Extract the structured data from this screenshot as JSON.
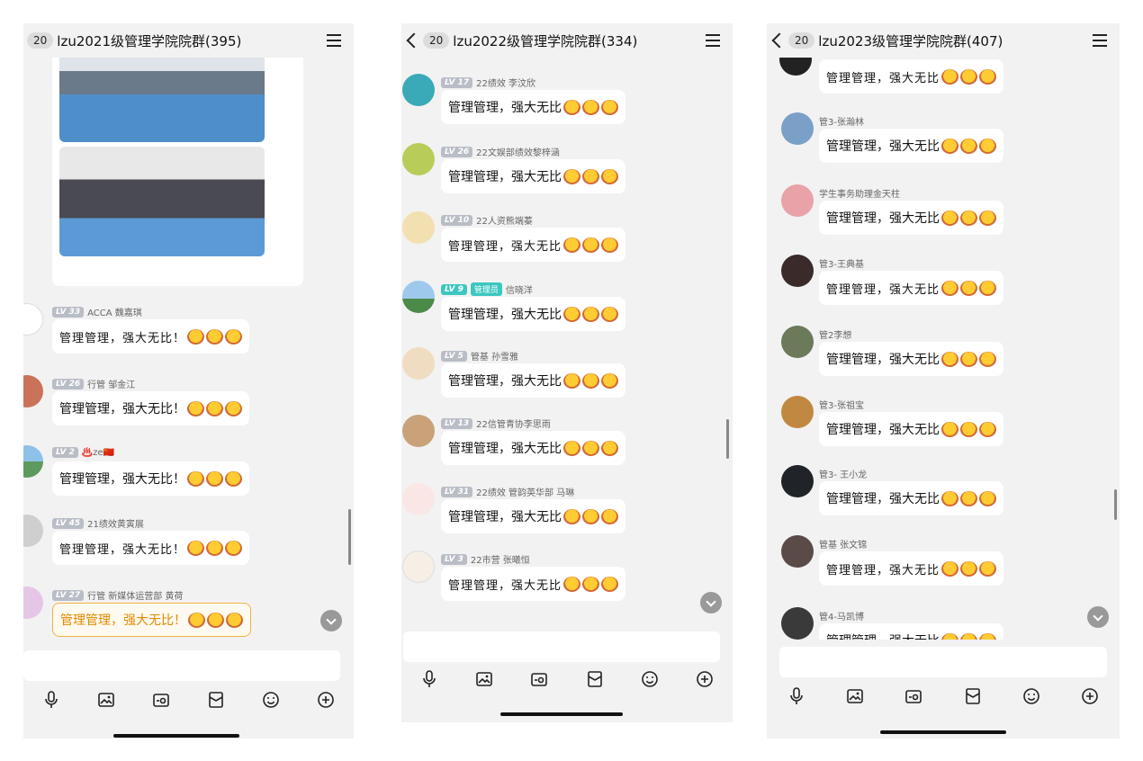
{
  "colors": {
    "lv_badge": "#b9bdc6",
    "admin_badge": "#3cc7c0",
    "bubble": "#ffffff",
    "background": "#f2f2f2"
  },
  "panels": [
    {
      "unread": "20",
      "title": "lzu2021级管理学院院群(395)",
      "messages": [
        {
          "level": "LV 33",
          "name": "ACCA 魏嘉琪",
          "text": "管理管理，强大无比！",
          "style": "hand"
        },
        {
          "level": "LV 26",
          "name": "行管 邹金江",
          "text": "管理管理，强大无比！",
          "style": "normal"
        },
        {
          "level": "LV 2",
          "name": "♨️ze🇨🇳",
          "text": "管理管理，强大无比！",
          "style": "normal"
        },
        {
          "level": "LV 45",
          "name": "21绩效黄寅展",
          "text": "管理管理，强大无比！",
          "style": "hand"
        },
        {
          "level": "LV 27",
          "name": "行管 新媒体运营部  黄荷",
          "text": "管理管理，强大无比！",
          "style": "special"
        }
      ]
    },
    {
      "unread": "20",
      "title": "lzu2022级管理学院院群(334)",
      "messages": [
        {
          "level": "LV 17",
          "name": "22绩效 李汶欣",
          "text": "管理管理，强大无比",
          "style": "normal"
        },
        {
          "level": "LV 26",
          "name": "22文娱部绩效黎梓涵",
          "text": "管理管理，强大无比",
          "style": "normal"
        },
        {
          "level": "LV 10",
          "name": "22人资熊端蓁",
          "text": "管理管理，强大无比",
          "style": "hand"
        },
        {
          "level": "LV 9",
          "role": "管理员",
          "name": "信晓洋",
          "text": "管理管理，强大无比",
          "style": "normal"
        },
        {
          "level": "LV 5",
          "name": "管基 孙雪雅",
          "text": "管理管理，强大无比",
          "style": "normal"
        },
        {
          "level": "LV 13",
          "name": "22信管青协李思雨",
          "text": "管理管理，强大无比",
          "style": "normal"
        },
        {
          "level": "LV 31",
          "name": "22绩效 管韵英华部 马琳",
          "text": "管理管理，强大无比",
          "style": "normal"
        },
        {
          "level": "LV 3",
          "name": "22市营 张曦恒",
          "text": "管理管理，强大无比",
          "style": "hand"
        }
      ]
    },
    {
      "unread": "20",
      "title": "lzu2023级管理学院院群(407)",
      "messages": [
        {
          "level": "",
          "name": "",
          "text": "管理管理，强大无比",
          "style": "hand"
        },
        {
          "level": "",
          "name": "管3-张瀚林",
          "text": "管理管理，强大无比",
          "style": "normal"
        },
        {
          "level": "",
          "name": "学生事务助理金天柱",
          "text": "管理管理，强大无比",
          "style": "normal"
        },
        {
          "level": "",
          "name": "管3-王典基",
          "text": "管理管理，强大无比",
          "style": "hand"
        },
        {
          "level": "",
          "name": "管2李想",
          "text": "管理管理，强大无比",
          "style": "normal"
        },
        {
          "level": "",
          "name": "管3-张祖宝",
          "text": "管理管理，强大无比",
          "style": "normal"
        },
        {
          "level": "",
          "name": "管3- 王小龙",
          "text": "管理管理，强大无比",
          "style": "normal"
        },
        {
          "level": "",
          "name": "管基 张文锦",
          "text": "管理管理，强大无比",
          "style": "hand"
        },
        {
          "level": "",
          "name": "管4-马凯博",
          "text": "管理管理，强大无比",
          "style": "normal"
        }
      ]
    }
  ],
  "toolbar_icons": [
    "microphone-icon",
    "image-icon",
    "camera-icon",
    "red-packet-icon",
    "emoji-icon",
    "plus-icon"
  ]
}
